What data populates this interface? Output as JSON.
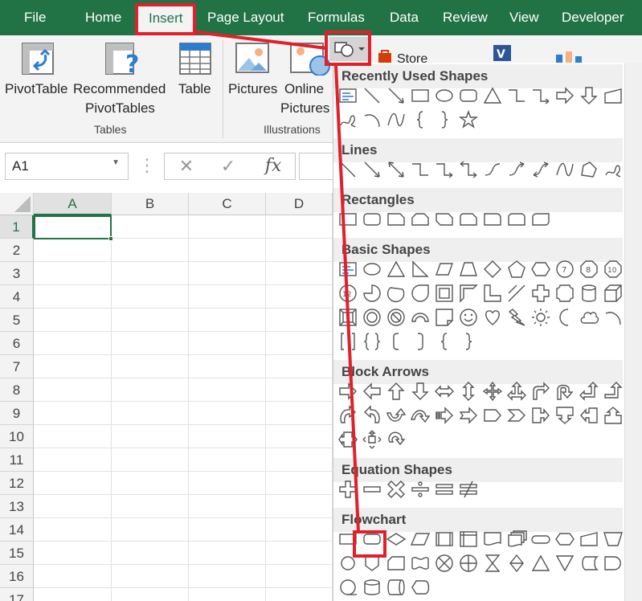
{
  "menu": {
    "items": [
      "File",
      "Home",
      "Insert",
      "Page Layout",
      "Formulas",
      "Data",
      "Review",
      "View",
      "Developer"
    ],
    "active": "Insert"
  },
  "ribbon": {
    "pivottable": "PivotTable",
    "recommended_line1": "Recommended",
    "recommended_line2": "PivotTables",
    "table": "Table",
    "pictures": "Pictures",
    "online_line1": "Online",
    "online_line2": "Pictures",
    "store": "Store",
    "group_tables": "Tables",
    "group_illustrations": "Illustrations"
  },
  "formula_bar": {
    "namebox_value": "A1",
    "cancel_symbol": "✕",
    "enter_symbol": "✓",
    "fx_symbol": "fx"
  },
  "grid": {
    "columns": [
      "A",
      "B",
      "C",
      "D"
    ],
    "rows": [
      "1",
      "2",
      "3",
      "4",
      "5",
      "6",
      "7",
      "8",
      "9",
      "10",
      "11",
      "12",
      "13",
      "14",
      "15",
      "16",
      "17"
    ],
    "active_cell": "A1"
  },
  "shapes_menu": {
    "sections": [
      {
        "title": "Recently Used Shapes",
        "shapes": [
          "text-box",
          "line",
          "arrow-line",
          "rectangle",
          "oval",
          "rounded-rectangle",
          "isosceles-triangle",
          "elbow-connector",
          "elbow-arrow-connector",
          "right-arrow",
          "down-arrow",
          "flowchart-manual-input",
          "freeform-scribble",
          "arc",
          "curve",
          "left-brace",
          "right-brace",
          "star-5-point"
        ]
      },
      {
        "title": "Lines",
        "shapes": [
          "line",
          "line-arrow",
          "line-double-arrow",
          "elbow-connector",
          "elbow-arrow-connector",
          "elbow-double-arrow-connector",
          "curved-connector",
          "curved-arrow-connector",
          "curved-double-arrow-connector",
          "curve",
          "freeform-shape",
          "freeform-scribble"
        ]
      },
      {
        "title": "Rectangles",
        "shapes": [
          "rectangle",
          "rounded-rectangle",
          "snip-single-corner",
          "snip-same-side",
          "snip-diagonal",
          "snip-round-single",
          "round-single-corner",
          "round-same-side",
          "round-diagonal"
        ]
      },
      {
        "title": "Basic Shapes",
        "shapes": [
          "text-box",
          "oval",
          "isosceles-triangle",
          "right-triangle",
          "parallelogram",
          "trapezoid",
          "diamond",
          "regular-pentagon",
          "hexagon",
          "heptagon",
          "octagon",
          "decagon",
          "dodecagon",
          "pie",
          "chord",
          "teardrop",
          "frame",
          "half-frame",
          "l-shape",
          "diagonal-stripe",
          "cross",
          "plaque",
          "can",
          "cube",
          "bevel",
          "donut",
          "no-symbol",
          "block-arc",
          "folded-corner",
          "smiley-face",
          "heart",
          "lightning-bolt",
          "sun",
          "moon",
          "cloud",
          "arc",
          "double-bracket",
          "double-brace",
          "left-bracket",
          "right-bracket",
          "left-brace",
          "right-brace"
        ]
      },
      {
        "title": "Block Arrows",
        "shapes": [
          "right-arrow",
          "left-arrow",
          "up-arrow",
          "down-arrow",
          "left-right-arrow",
          "up-down-arrow",
          "quad-arrow",
          "left-right-up-arrow",
          "bent-arrow",
          "u-turn-arrow",
          "left-up-arrow",
          "bent-up-arrow",
          "curved-right-arrow",
          "curved-left-arrow",
          "curved-up-arrow",
          "curved-down-arrow",
          "striped-right-arrow",
          "notched-right-arrow",
          "pentagon-arrow",
          "chevron",
          "right-arrow-callout",
          "down-arrow-callout",
          "left-arrow-callout",
          "up-arrow-callout",
          "left-right-arrow-callout",
          "quad-arrow-callout",
          "circular-arrow"
        ]
      },
      {
        "title": "Equation Shapes",
        "shapes": [
          "plus",
          "minus",
          "multiply",
          "division",
          "equal",
          "not-equal"
        ]
      },
      {
        "title": "Flowchart",
        "shapes": [
          "process",
          "alternate-process",
          "decision",
          "data",
          "predefined-process",
          "internal-storage",
          "document",
          "multidocument",
          "terminator",
          "preparation",
          "manual-input",
          "manual-operation",
          "connector",
          "off-page-connector",
          "card",
          "punched-tape",
          "summing-junction",
          "or",
          "collate",
          "sort",
          "extract",
          "merge",
          "stored-data",
          "delay",
          "sequential-access-storage",
          "magnetic-disk",
          "direct-access-storage",
          "display"
        ]
      }
    ],
    "highlighted_shape": "alternate-process"
  },
  "annotation": {
    "color": "#e0202b"
  },
  "colors": {
    "excel_green": "#217346",
    "ribbon_bg": "#f3f3f3",
    "header_bg": "#efefef"
  }
}
